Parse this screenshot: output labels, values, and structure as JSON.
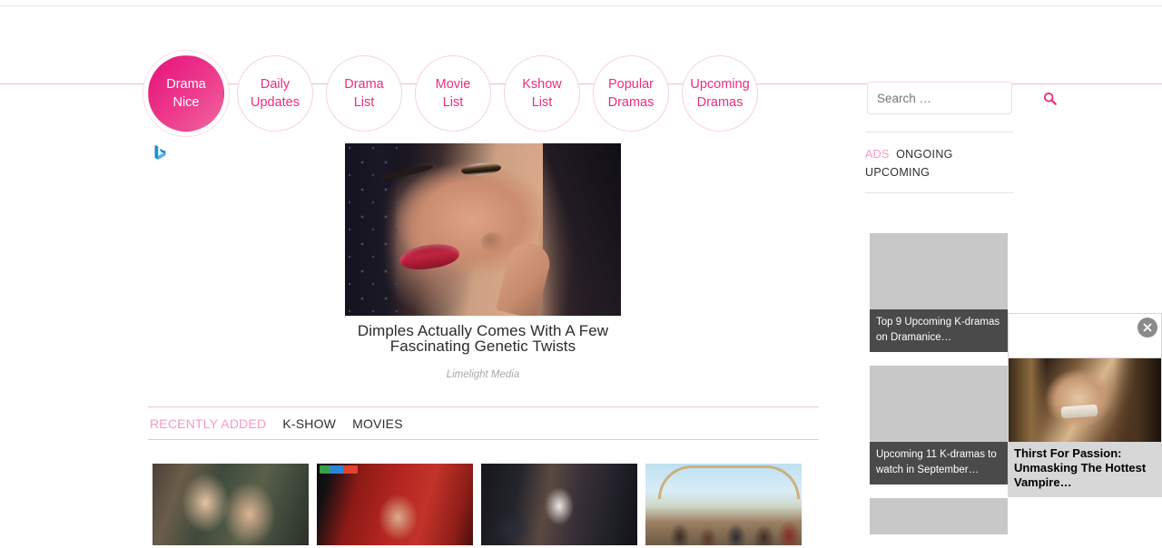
{
  "site": {
    "logo_icon": "bing-b-logo"
  },
  "nav": {
    "items": [
      {
        "line1": "Drama",
        "line2": "Nice",
        "active": true
      },
      {
        "line1": "Daily",
        "line2": "Updates",
        "active": false
      },
      {
        "line1": "Drama",
        "line2": "List",
        "active": false
      },
      {
        "line1": "Movie",
        "line2": "List",
        "active": false
      },
      {
        "line1": "Kshow",
        "line2": "List",
        "active": false
      },
      {
        "line1": "Popular",
        "line2": "Dramas",
        "active": false
      },
      {
        "line1": "Upcoming",
        "line2": "Dramas",
        "active": false
      }
    ]
  },
  "search": {
    "placeholder": "Search …",
    "value": "",
    "icon": "search-icon"
  },
  "video": {
    "title": "Dimples Actually Comes With A Few Fascinating Genetic Twists",
    "credit": "Limelight Media"
  },
  "content_tabs": {
    "items": [
      {
        "label": "RECENTLY ADDED",
        "active": true
      },
      {
        "label": "K-SHOW",
        "active": false
      },
      {
        "label": "MOVIES",
        "active": false
      }
    ]
  },
  "thumbnails": [
    {
      "name": "drama-thumbnail-1"
    },
    {
      "name": "drama-thumbnail-2"
    },
    {
      "name": "drama-thumbnail-3"
    },
    {
      "name": "drama-thumbnail-4"
    }
  ],
  "sidebar": {
    "tabs": [
      {
        "label": "ADS",
        "active": true
      },
      {
        "label": "ONGOING",
        "active": false
      },
      {
        "label": "UPCOMING",
        "active": false
      }
    ],
    "ads": [
      {
        "caption": "Top 9 Upcoming K-dramas on Dramanice…"
      },
      {
        "caption": "Upcoming 11 K-dramas to watch in September…"
      },
      {
        "caption": ""
      }
    ]
  },
  "floating_ad": {
    "caption": "Thirst For Passion: Unmasking The Hottest Vampire…",
    "close_icon": "close-icon"
  },
  "colors": {
    "accent_pink": "#ec2d7e",
    "accent_pink_light": "#f79ac3",
    "rule_pink": "#f2b9d0",
    "caption_dark": "#4a4a4a"
  }
}
